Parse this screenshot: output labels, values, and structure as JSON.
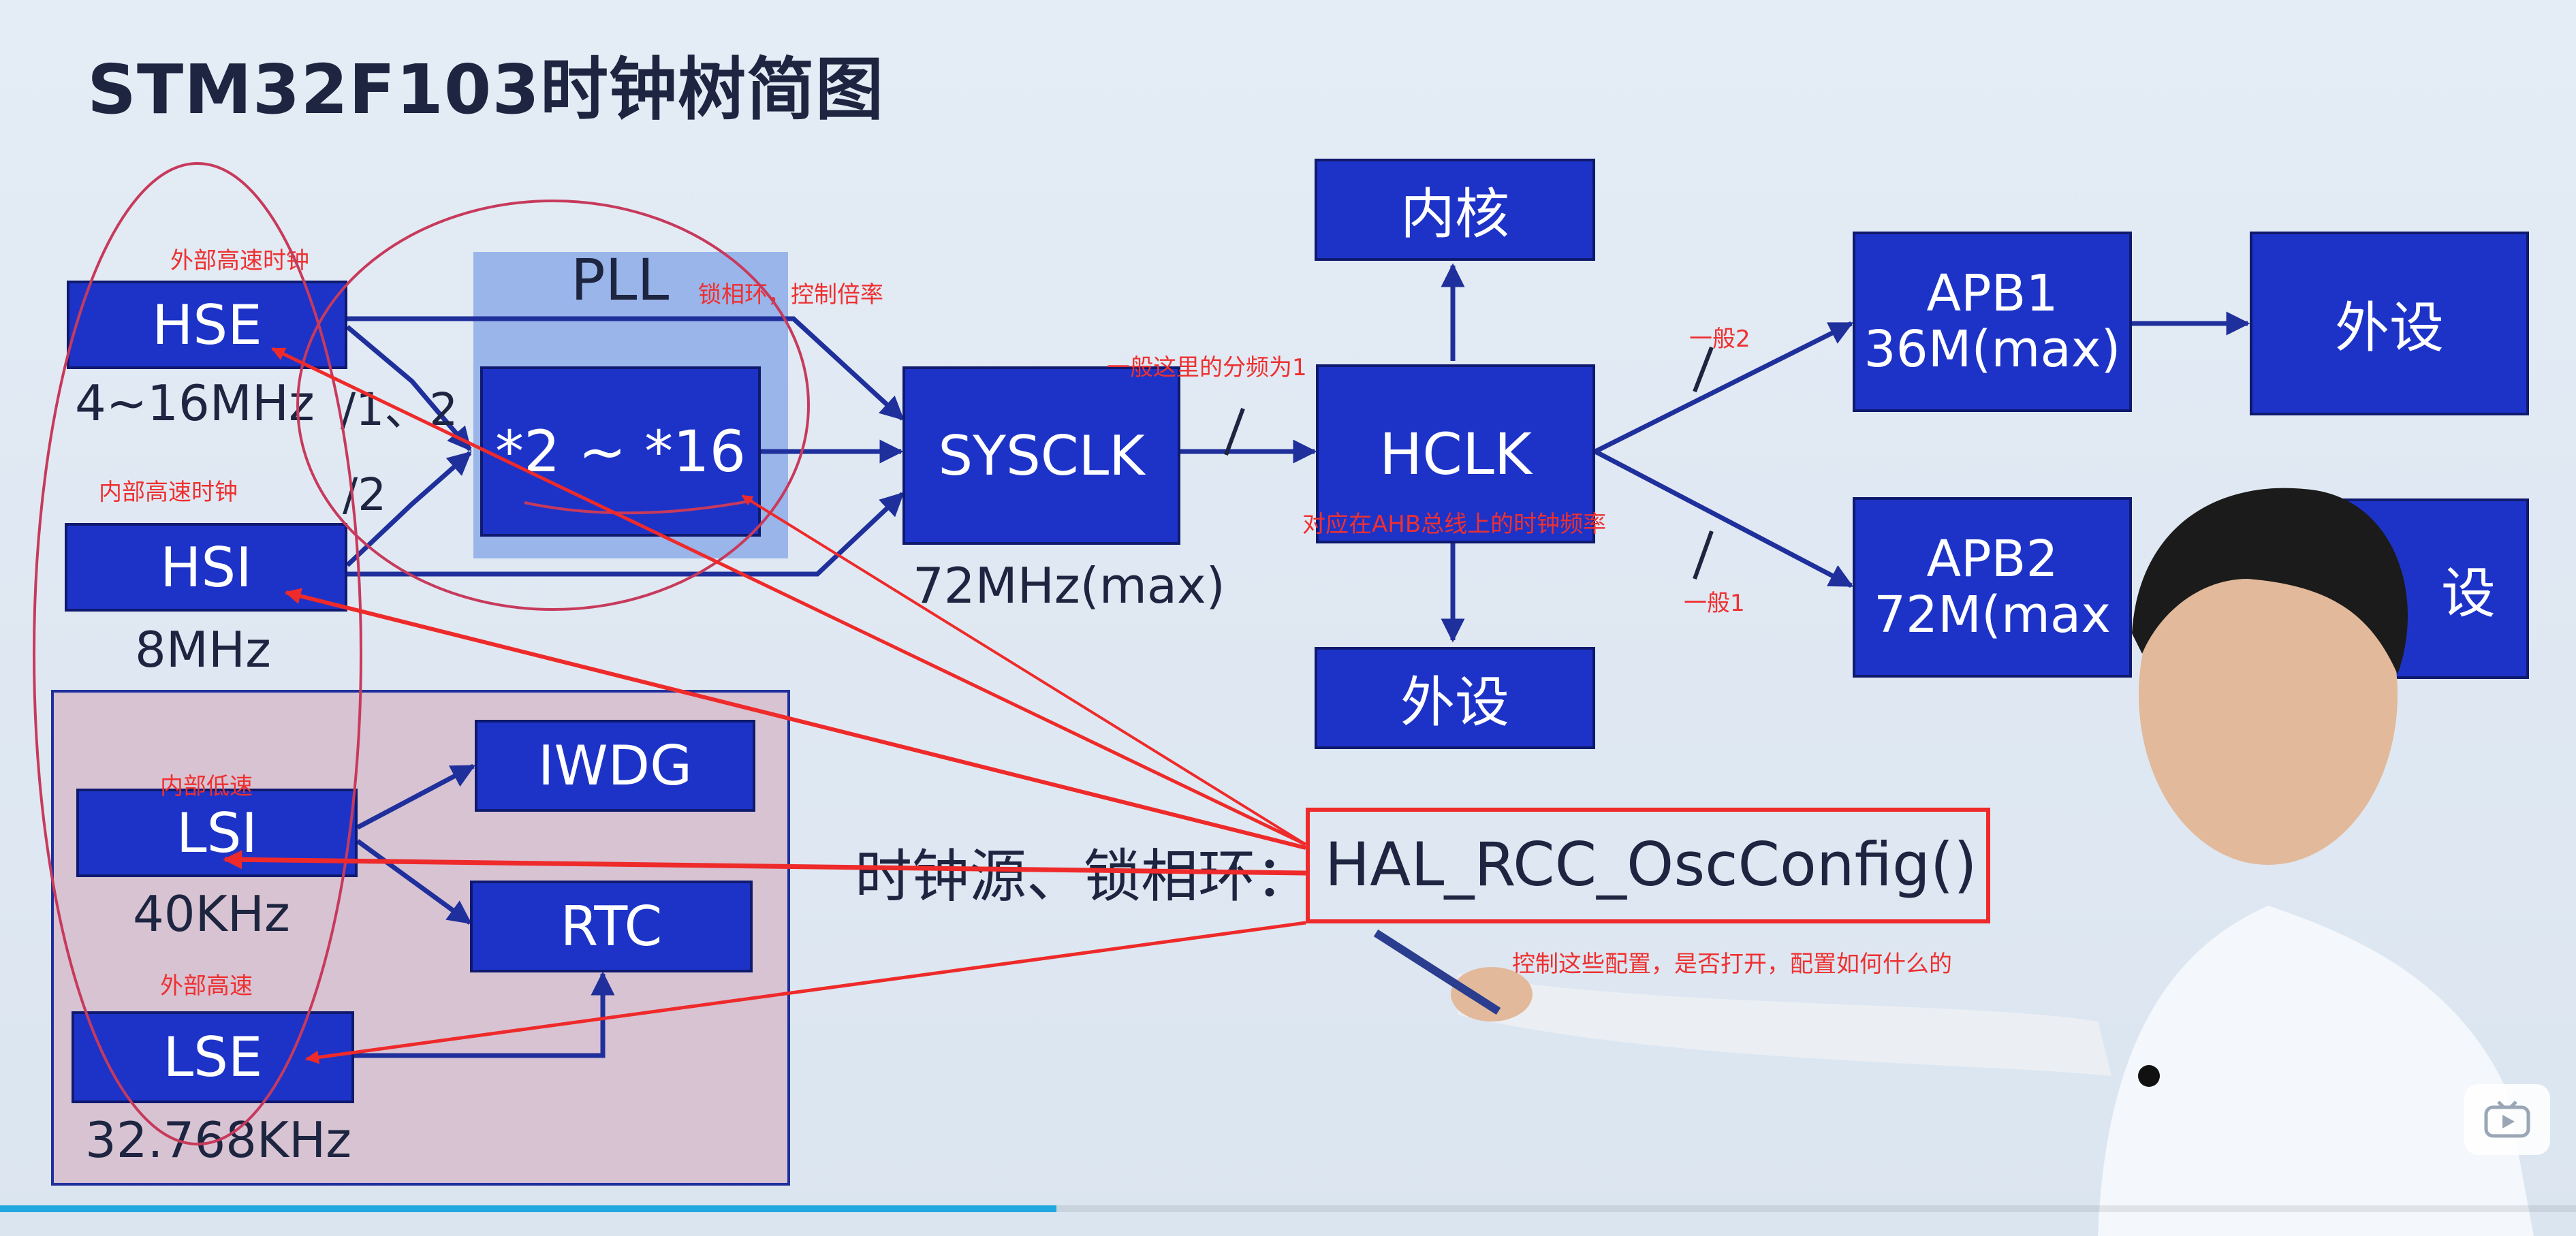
{
  "slide": {
    "title": "STM32F103时钟树简图"
  },
  "blocks": {
    "hse": {
      "label": "HSE",
      "freq": "4~16MHz"
    },
    "hsi": {
      "label": "HSI",
      "freq": "8MHz"
    },
    "pll": {
      "label": "PLL",
      "multiplier": "*2 ~ *16"
    },
    "sysclk": {
      "label": "SYSCLK",
      "freq": "72MHz(max)"
    },
    "hclk": {
      "label": "HCLK"
    },
    "core": {
      "label": "内核"
    },
    "periph_ahb": {
      "label": "外设"
    },
    "apb1": {
      "label": "APB1",
      "freq": "36M(max)"
    },
    "apb2": {
      "label": "APB2",
      "freq": "72M(max"
    },
    "periph_apb1": {
      "label": "外设"
    },
    "periph_apb2": {
      "label": "设"
    },
    "lsi": {
      "label": "LSI",
      "freq": "40KHz"
    },
    "lse": {
      "label": "LSE",
      "freq": "32.768KHz"
    },
    "iwdg": {
      "label": "IWDG"
    },
    "rtc": {
      "label": "RTC"
    }
  },
  "dividers": {
    "hse_div": "/1、2",
    "hsi_div": "/2"
  },
  "caption": {
    "prefix": "时钟源、锁相环：",
    "function": "HAL_RCC_OscConfig()"
  },
  "notes": {
    "hse": "外部高速时钟",
    "hsi": "内部高速时钟",
    "lsi": "内部低速",
    "lse": "外部高速",
    "pll": "锁相环，控制倍率",
    "ahb_div": "一般这里的分频为1",
    "hclk": "对应在AHB总线上的时钟频率",
    "apb1_div": "一般2",
    "apb2_div": "一般1",
    "osc_config": "控制这些配置，是否打开，配置如何什么的"
  },
  "colors": {
    "block": "#1d33c8",
    "arrow": "#1f2f9b",
    "annotation": "#ee3030",
    "pll_panel": "#99b5ea",
    "low_speed_panel": "#d8c3d3"
  },
  "player": {
    "progress": 0.41
  }
}
